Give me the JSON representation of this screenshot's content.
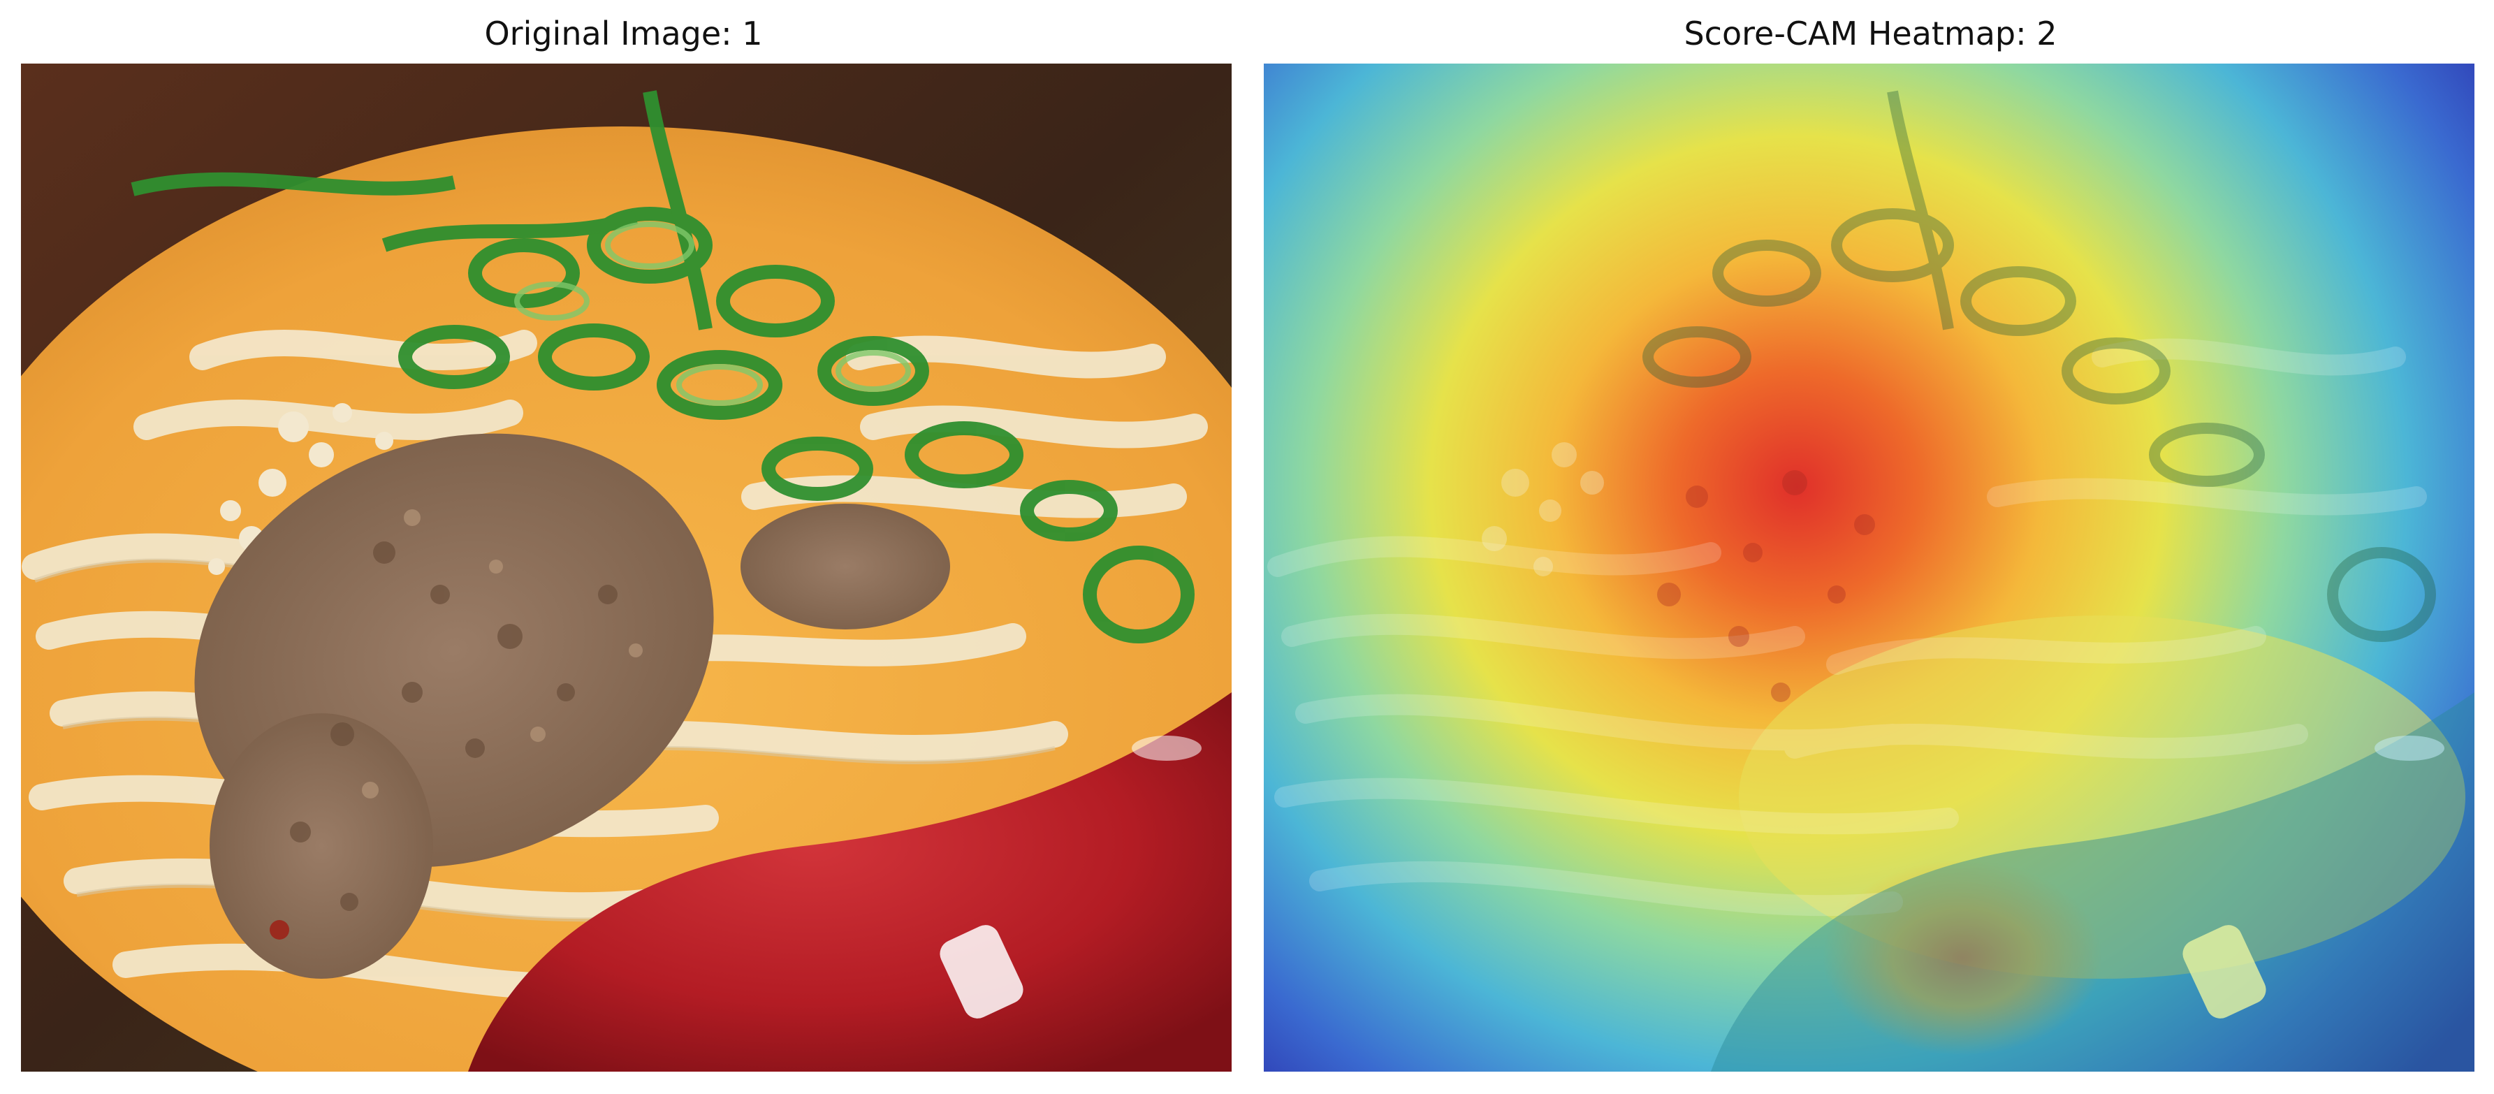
{
  "figure": {
    "left_panel": {
      "title": "Original Image: 1",
      "image_subject": "dan-dan-noodles-with-ground-meat-green-onions-and-red-spoon"
    },
    "right_panel": {
      "title": "Score-CAM Heatmap: 2",
      "image_subject": "score-cam-heatmap-overlay-on-noodle-bowl",
      "colormap": "jet"
    },
    "colors": {
      "background": "#ffffff",
      "broth": "#f2a436",
      "noodle": "#f1e2c0",
      "meat": "#8a6e58",
      "green_onion": "#2f8f2f",
      "spoon": "#b81c24"
    }
  }
}
